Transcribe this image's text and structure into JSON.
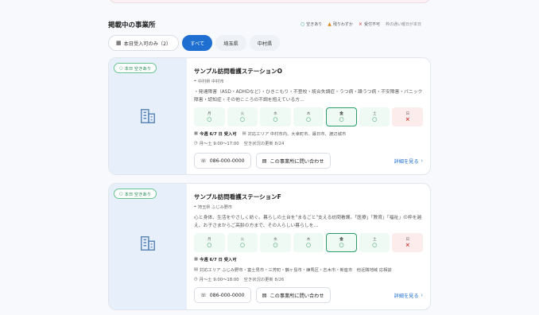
{
  "section_title": "掲載中の事業所",
  "legend": {
    "available": "空きあり",
    "few": "残りわずか",
    "closed": "受付不可",
    "note": "枠の通い曜日が本日"
  },
  "filters": [
    {
      "label": "本日受入可のみ（2）",
      "active": false
    },
    {
      "label": "すべて",
      "active": true
    },
    {
      "label": "埼玉県",
      "active": false
    },
    {
      "label": "中村県",
      "active": false
    }
  ],
  "cards": [
    {
      "badge": "本日 空きあり",
      "name": "サンプル訪問看護ステーションO",
      "location": "中村県 中村市",
      "description": "・発達障害（ASD・ADHDなど）・ひきこもり・不登校・統合失調症・うつ病・躁うつ病・不安障害・パニック障害・認知症・その他こころの不調を抱えている方…",
      "days": [
        {
          "label": "月",
          "status": "○"
        },
        {
          "label": "火",
          "status": "○"
        },
        {
          "label": "水",
          "status": "○"
        },
        {
          "label": "木",
          "status": "○"
        },
        {
          "label": "金",
          "status": "○"
        },
        {
          "label": "土",
          "status": "○"
        },
        {
          "label": "日",
          "status": "×"
        }
      ],
      "today_accept": "今週 6/7 日 受入可",
      "area": "対応エリア 中村市内、大幸町市、最日市、渡辺城市",
      "hours": "月〜土 9:00〜17:00",
      "updated": "空き状況の更新 8/24",
      "phone": "086-000-0000",
      "contact": "この事業所に問い合わせ",
      "detail": "詳細を見る"
    },
    {
      "badge": "本日 空きあり",
      "name": "サンプル訪問看護ステーションF",
      "location": "埼玉県 ふじみ野市",
      "description": "心と身体、生活をやさしく紡ぐ。暮らしの土台を\"まるごと\"支える訪問看護。「医療」「教育」「福祉」の枠を越え、お子さまからご高齢の方まで、その人らしい暮らしを…",
      "days": [
        {
          "label": "月",
          "status": "○"
        },
        {
          "label": "火",
          "status": "○"
        },
        {
          "label": "水",
          "status": "○"
        },
        {
          "label": "木",
          "status": "○"
        },
        {
          "label": "金",
          "status": "○"
        },
        {
          "label": "土",
          "status": "○"
        },
        {
          "label": "日",
          "status": "×"
        }
      ],
      "today_accept": "今週 6/7 日 受入可",
      "area": "対応エリア ふじみ野市・富士見市・三芳町・鶴ヶ島市・練馬区・志木市・新座市　他近隣地域 応相談",
      "hours": "月〜土 9:00〜18:00",
      "updated": "空き状況の更新 8/26",
      "phone": "086-000-0000",
      "contact": "この事業所に問い合わせ",
      "detail": "詳細を見る"
    }
  ]
}
